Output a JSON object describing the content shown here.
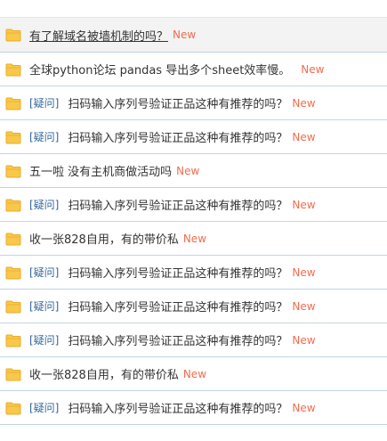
{
  "colors": {
    "folder": "#f9c84a",
    "folder_dark": "#e8ad2a",
    "tag": "#336699",
    "title": "#333333",
    "new_badge": "#f26c4f",
    "divider": "#c2d5e3",
    "hover_bg": "#f3f3f3"
  },
  "threads": [
    {
      "icon": "folder-icon",
      "tag": "",
      "title": "有了解域名被墙机制的吗？",
      "badge": "New"
    },
    {
      "icon": "folder-icon",
      "tag": "",
      "title": "全球python论坛 pandas 导出多个sheet效率慢。",
      "badge": "New"
    },
    {
      "icon": "folder-icon",
      "tag": "[疑问]",
      "title": "扫码输入序列号验证正品这种有推荐的吗？",
      "badge": "New"
    },
    {
      "icon": "folder-icon",
      "tag": "[疑问]",
      "title": "扫码输入序列号验证正品这种有推荐的吗？",
      "badge": "New"
    },
    {
      "icon": "folder-icon",
      "tag": "",
      "title": "五一啦 没有主机商做活动吗",
      "badge": "New"
    },
    {
      "icon": "folder-icon",
      "tag": "[疑问]",
      "title": "扫码输入序列号验证正品这种有推荐的吗？",
      "badge": "New"
    },
    {
      "icon": "folder-icon",
      "tag": "",
      "title": "收一张828自用，有的带价私",
      "badge": "New"
    },
    {
      "icon": "folder-icon",
      "tag": "[疑问]",
      "title": "扫码输入序列号验证正品这种有推荐的吗？",
      "badge": "New"
    },
    {
      "icon": "folder-icon",
      "tag": "[疑问]",
      "title": "扫码输入序列号验证正品这种有推荐的吗？",
      "badge": "New"
    },
    {
      "icon": "folder-icon",
      "tag": "[疑问]",
      "title": "扫码输入序列号验证正品这种有推荐的吗？",
      "badge": "New"
    },
    {
      "icon": "folder-icon",
      "tag": "",
      "title": "收一张828自用，有的带价私",
      "badge": "New"
    },
    {
      "icon": "folder-icon",
      "tag": "[疑问]",
      "title": "扫码输入序列号验证正品这种有推荐的吗？",
      "badge": "New"
    }
  ]
}
